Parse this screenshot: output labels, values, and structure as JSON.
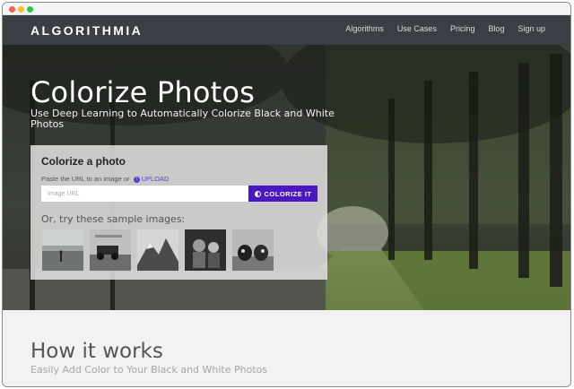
{
  "nav": {
    "logo": "ALGORITHMIA",
    "links": [
      "Algorithms",
      "Use Cases",
      "Pricing",
      "Blog",
      "Sign up"
    ]
  },
  "hero": {
    "title": "Colorize Photos",
    "subtitle": "Use Deep Learning to Automatically Colorize Black and White Photos"
  },
  "card": {
    "title": "Colorize a photo",
    "hint": "Paste the URL to an image or",
    "upload_label": "UPLOAD",
    "url_placeholder": "Image URL",
    "colorize_label": "COLORIZE IT",
    "samples_label": "Or, try these sample images:",
    "samples": [
      "sample-beach",
      "sample-race-cars",
      "sample-mountain",
      "sample-people",
      "sample-cows"
    ]
  },
  "how": {
    "title": "How it works",
    "subtitle": "Easily Add Color to Your Black and White Photos"
  },
  "colors": {
    "nav_bg": "#3b3e44",
    "accent": "#4a17c2",
    "section_bg": "#f2f2f2"
  }
}
